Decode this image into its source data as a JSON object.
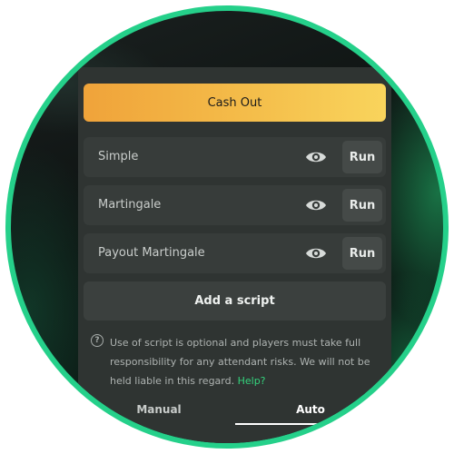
{
  "cash_out": {
    "label": "Cash Out"
  },
  "scripts": [
    {
      "name": "Simple",
      "run_label": "Run",
      "icon": "eye-icon"
    },
    {
      "name": "Martingale",
      "run_label": "Run",
      "icon": "eye-icon"
    },
    {
      "name": "Payout Martingale",
      "run_label": "Run",
      "icon": "eye-icon"
    }
  ],
  "add_script": {
    "label": "Add a script"
  },
  "disclaimer": {
    "icon": "question-circle-icon",
    "text": "Use of script is optional and players must take full responsibility for any attendant risks. We will not be held liable in this regard.",
    "help_link": "Help?"
  },
  "tabs": [
    {
      "label": "Manual",
      "active": false
    },
    {
      "label": "Auto",
      "active": true
    }
  ],
  "colors": {
    "accent_green": "#25d08a",
    "help_link": "#34d37c",
    "cash_out_start": "#f0a33a",
    "cash_out_end": "#f9d45c",
    "panel": "#2f3432"
  }
}
